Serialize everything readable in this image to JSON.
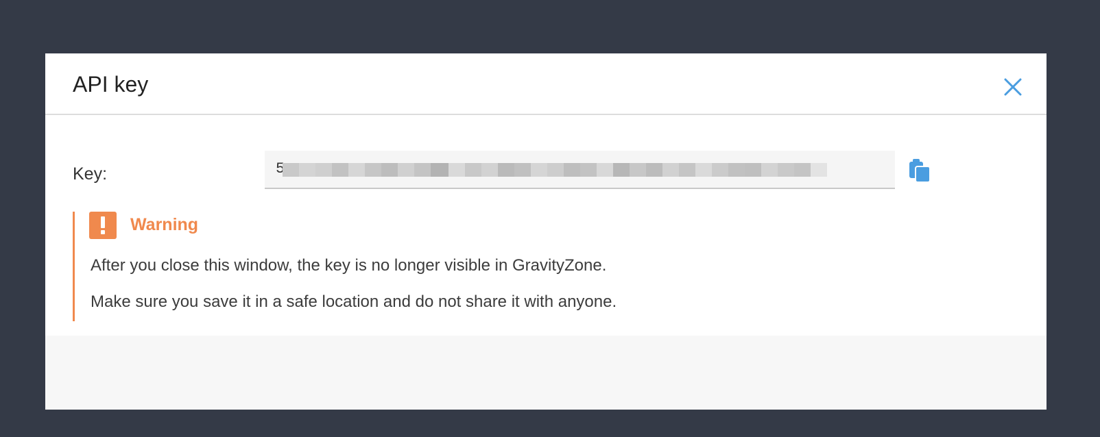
{
  "dialog": {
    "title": "API key",
    "close_icon": "close-icon"
  },
  "key": {
    "label": "Key:",
    "value_visible": "5",
    "value_masked": true
  },
  "copy": {
    "icon": "clipboard-copy-icon"
  },
  "warning": {
    "icon": "exclamation-icon",
    "title": "Warning",
    "line1": "After you close this window, the key is no longer visible in GravityZone.",
    "line2": "Make sure you save it in a safe location and do not share it with anyone."
  },
  "colors": {
    "backdrop": "#343a47",
    "accent": "#4a9de0",
    "warning": "#f0894d"
  }
}
